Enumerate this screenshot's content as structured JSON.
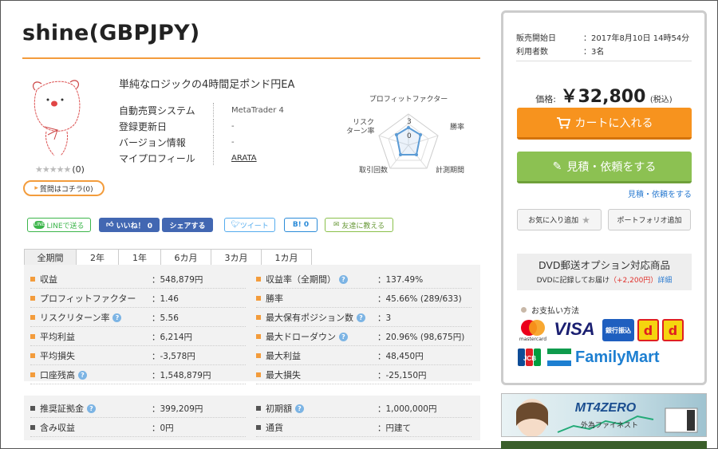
{
  "title": "shine(GBPJPY)",
  "subtitle": "単純なロジックの4時間足ポンド円EA",
  "rating": {
    "stars": "★★★★★",
    "count": "(0)"
  },
  "question_button": "質問はコチラ(0)",
  "info": [
    {
      "label": "自動売買システム",
      "value": "MetaTrader 4"
    },
    {
      "label": "登録更新日",
      "value": "-"
    },
    {
      "label": "バージョン情報",
      "value": "-"
    },
    {
      "label": "マイプロフィール",
      "value": "ARATA"
    }
  ],
  "radar": {
    "labels": [
      "プロフィットファクター",
      "勝率",
      "計測期間",
      "取引回数",
      "リスクリターン率"
    ],
    "label_lines": {
      "risk1": "リスク",
      "risk2": "ターン率"
    },
    "scale_max": "3",
    "scale_min": "0"
  },
  "social": {
    "line": "LINEで送る",
    "line_icon": "LINE",
    "like": "いいね！ 0",
    "share": "シェアする",
    "tweet": "ツイート",
    "hatena": "B! 0",
    "friend": "友達に教える"
  },
  "tabs": [
    "全期間",
    "2年",
    "1年",
    "6カ月",
    "3カ月",
    "1カ月"
  ],
  "stats_left": [
    {
      "label": "収益",
      "value": "548,879円",
      "help": false
    },
    {
      "label": "プロフィットファクター",
      "value": "1.46",
      "help": false
    },
    {
      "label": "リスクリターン率",
      "value": "5.56",
      "help": true
    },
    {
      "label": "平均利益",
      "value": "6,214円",
      "help": false
    },
    {
      "label": "平均損失",
      "value": "-3,578円",
      "help": false
    },
    {
      "label": "口座残高",
      "value": "1,548,879円",
      "help": true
    }
  ],
  "stats_right": [
    {
      "label": "収益率（全期間）",
      "value": "137.49%",
      "help": true
    },
    {
      "label": "勝率",
      "value": "45.66% (289/633)",
      "help": false
    },
    {
      "label": "最大保有ポジション数",
      "value": "3",
      "help": true
    },
    {
      "label": "最大ドローダウン",
      "value": "20.96% (98,675円)",
      "help": true
    },
    {
      "label": "最大利益",
      "value": "48,450円",
      "help": false
    },
    {
      "label": "最大損失",
      "value": "-25,150円",
      "help": false
    }
  ],
  "stats2_left": [
    {
      "label": "推奨証拠金",
      "value": "399,209円",
      "help": true
    },
    {
      "label": "含み収益",
      "value": "0円",
      "help": false
    }
  ],
  "stats2_right": [
    {
      "label": "初期額",
      "value": "1,000,000円",
      "help": true
    },
    {
      "label": "通貨",
      "value": "円建て",
      "help": false
    }
  ],
  "sidebar": {
    "sale_start_label": "販売開始日",
    "sale_start_value": "：2017年8月10日 14時54分",
    "users_label": "利用者数",
    "users_value": "：3名",
    "price_label": "価格:",
    "price_value": "￥32,800",
    "price_tax": "(税込)",
    "cart_button": "カートに入れる",
    "estimate_button": "見積・依頼をする",
    "estimate_link": "見積・依頼をする",
    "favorite_button": "お気に入り追加",
    "portfolio_button": "ポートフォリオ追加",
    "dvd_title": "DVD郵送オプション対応商品",
    "dvd_desc": "DVDに記録してお届け",
    "dvd_price": "（+2,200円）",
    "dvd_link": "詳細",
    "pay_title": "お支払い方法",
    "pay_logos": {
      "mastercard": "mastercard",
      "visa": "VISA",
      "bank": "銀行振込",
      "jcb": "JCB",
      "familymart": "FamilyMart"
    }
  },
  "ads": {
    "mt4zero": "MT4ZERO",
    "gaitame": "外為ファイネスト"
  },
  "colors": {
    "accent": "#f39c3c",
    "cart": "#f7931e",
    "estimate": "#8cc152",
    "link": "#2b7bd0"
  }
}
